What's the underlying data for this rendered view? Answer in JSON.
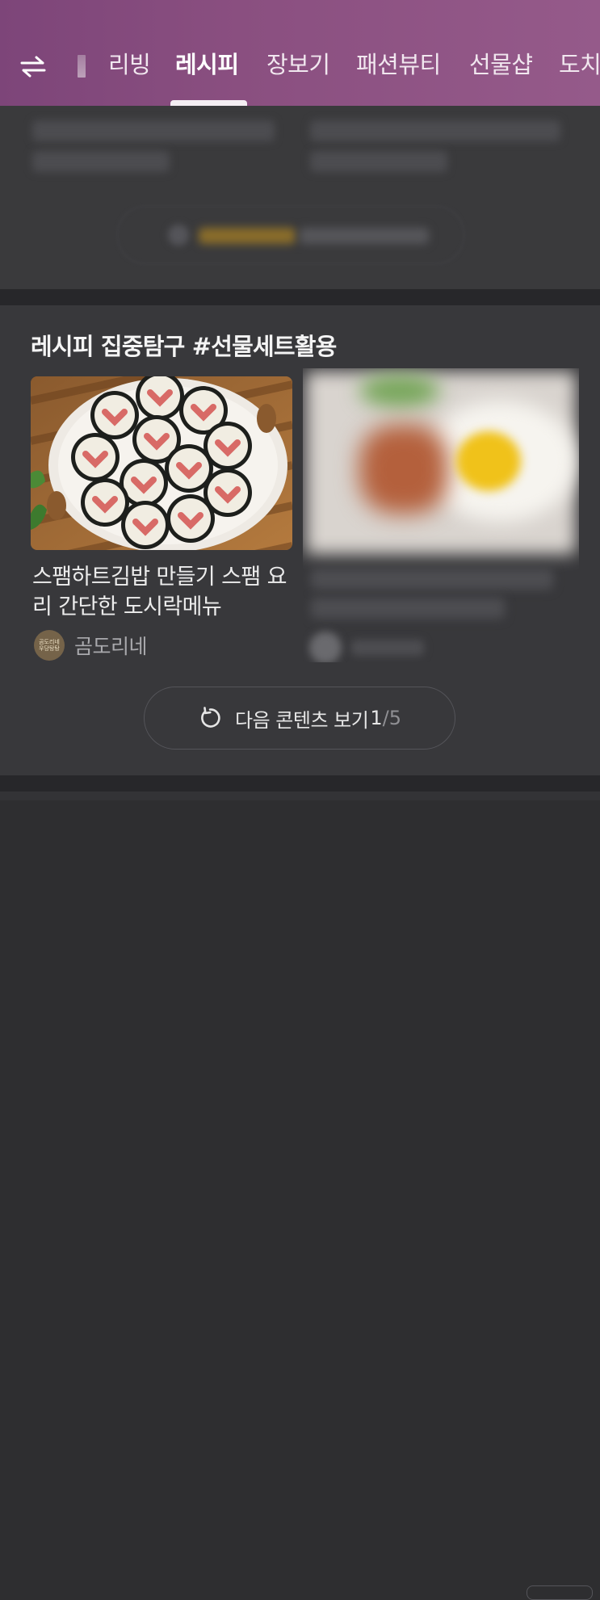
{
  "nav": {
    "tabs": [
      {
        "label": "리빙",
        "active": false
      },
      {
        "label": "레시피",
        "active": true
      },
      {
        "label": "장보기",
        "active": false
      },
      {
        "label": "패션뷰티",
        "active": false
      },
      {
        "label": "선물샵",
        "active": false
      },
      {
        "label": "도치",
        "active": false
      }
    ],
    "swap_icon": "swap-arrows-icon"
  },
  "section": {
    "title": "레시피 집중탐구 #선물세트활용",
    "items": [
      {
        "title": "스팸하트김밥 만들기 스팸 요리 간단한 도시락메뉴",
        "author": {
          "name": "곰도리네",
          "avatar_text_line1": "곰도리네",
          "avatar_text_line2": "우당탕탕"
        }
      }
    ],
    "next_button": {
      "label": "다음 콘텐츠 보기",
      "current_page": "1",
      "separator": "/",
      "total_pages": "5",
      "icon": "refresh-icon"
    }
  },
  "colors": {
    "nav_gradient_start": "#7d4579",
    "nav_gradient_end": "#955a8a",
    "background": "#2e2e30",
    "card": "#38383b"
  }
}
